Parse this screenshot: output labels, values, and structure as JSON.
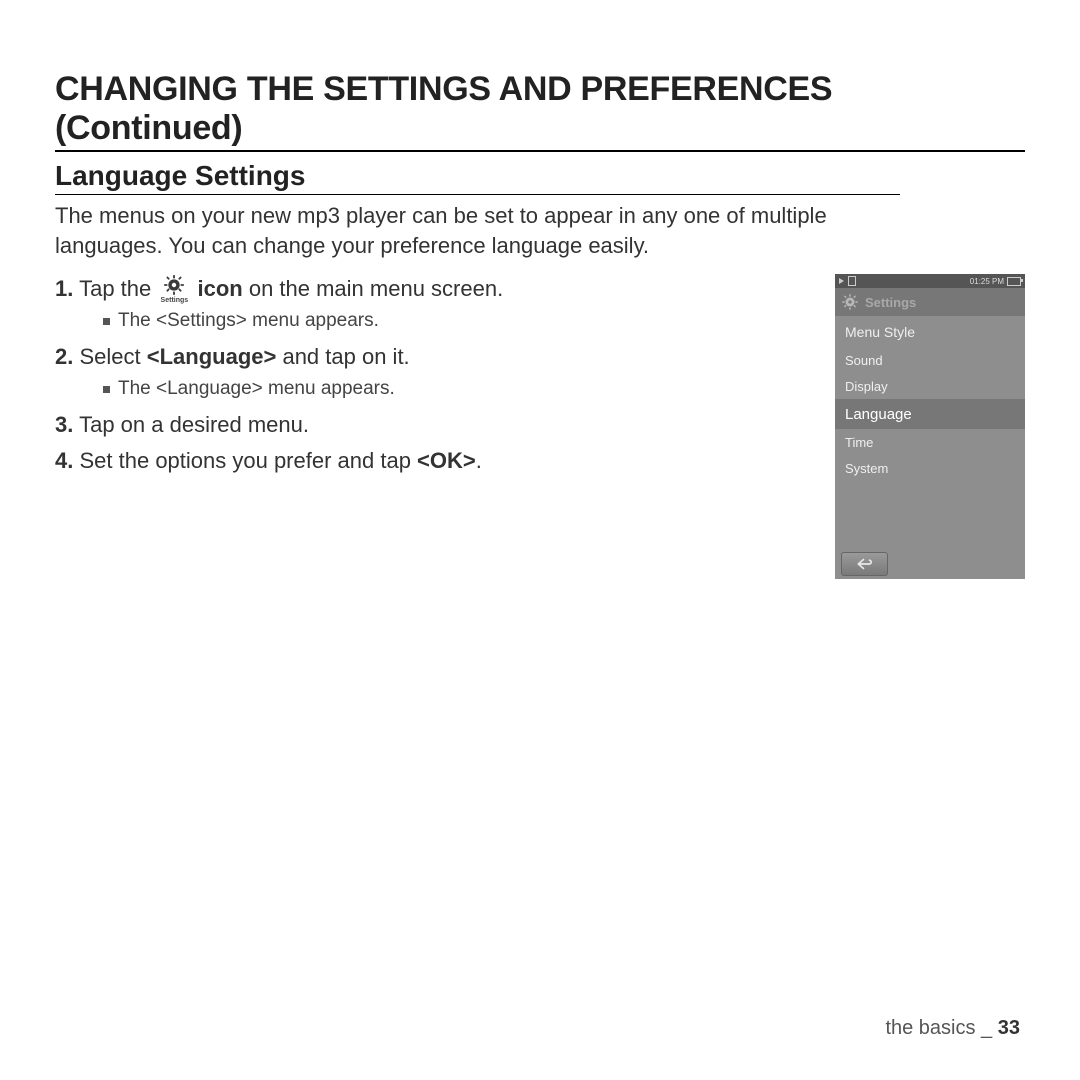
{
  "heading": "CHANGING THE SETTINGS AND PREFERENCES (Continued)",
  "subheading": "Language Settings",
  "intro": "The menus on your new mp3 player can be set to appear in any one of multiple languages. You can change your preference language easily.",
  "steps": {
    "s1a": "Tap the ",
    "s1b": " icon",
    "s1c": " on the main menu screen.",
    "s1_sub": "The <Settings> menu appears.",
    "s2a": "Select ",
    "s2b": "<Language>",
    "s2c": " and tap on it.",
    "s2_sub": "The <Language> menu appears.",
    "s3": "Tap on a desired menu.",
    "s4a": "Set the options you prefer and tap ",
    "s4b": "<OK>",
    "s4c": "."
  },
  "inline_icon_caption": "Settings",
  "device": {
    "status_time": "01:25 PM",
    "title": "Settings",
    "items": [
      "Menu Style",
      "Sound",
      "Display",
      "Language",
      "Time",
      "System"
    ],
    "selected_index": 3
  },
  "footer": {
    "section": "the basics",
    "sep": " _ ",
    "page": "33"
  }
}
